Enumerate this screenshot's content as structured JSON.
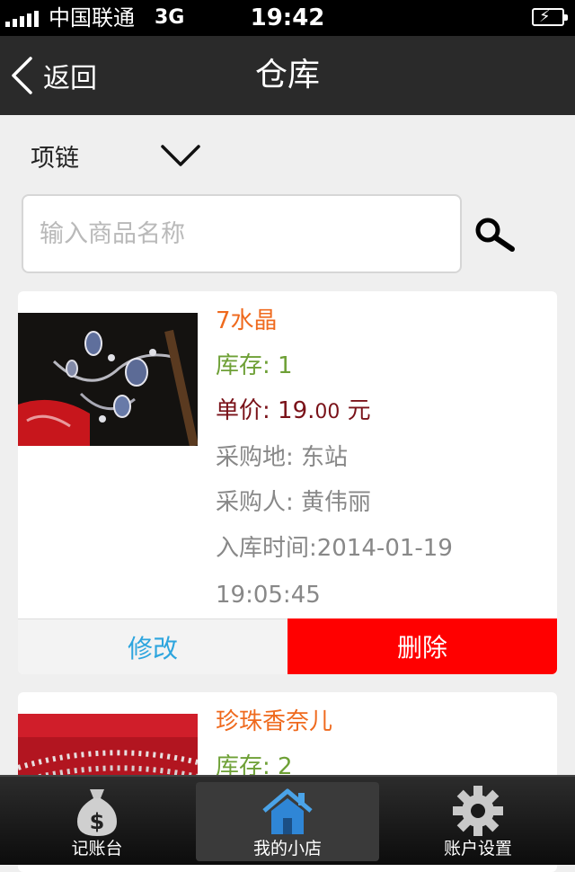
{
  "status_bar": {
    "carrier": "中国联通",
    "network": "3G",
    "time": "19:42"
  },
  "nav": {
    "back_label": "返回",
    "title": "仓库"
  },
  "filter": {
    "category": "项链"
  },
  "search": {
    "placeholder": "输入商品名称"
  },
  "products": [
    {
      "name": "7水晶",
      "stock_label": "库存:",
      "stock": "1",
      "price_label": "单价:",
      "price": "19.",
      "price_cents": "00",
      "currency": "元",
      "location_label": "采购地:",
      "location": "东站",
      "buyer_label": "采购人:",
      "buyer": "黄伟丽",
      "time_label": "入库时间:",
      "time": "2014-01-19 19:05:45",
      "edit_label": "修改",
      "delete_label": "删除"
    },
    {
      "name": "珍珠香奈儿",
      "stock_label": "库存:",
      "stock": "2"
    }
  ],
  "tabs": [
    {
      "label": "记账台",
      "icon": "money-bag-icon"
    },
    {
      "label": "我的小店",
      "icon": "home-icon"
    },
    {
      "label": "账户设置",
      "icon": "gear-icon"
    }
  ],
  "colors": {
    "name": "#ef6a1e",
    "stock": "#6ea036",
    "price": "#7a1219",
    "edit": "#2da5de",
    "delete": "#ff0000"
  }
}
